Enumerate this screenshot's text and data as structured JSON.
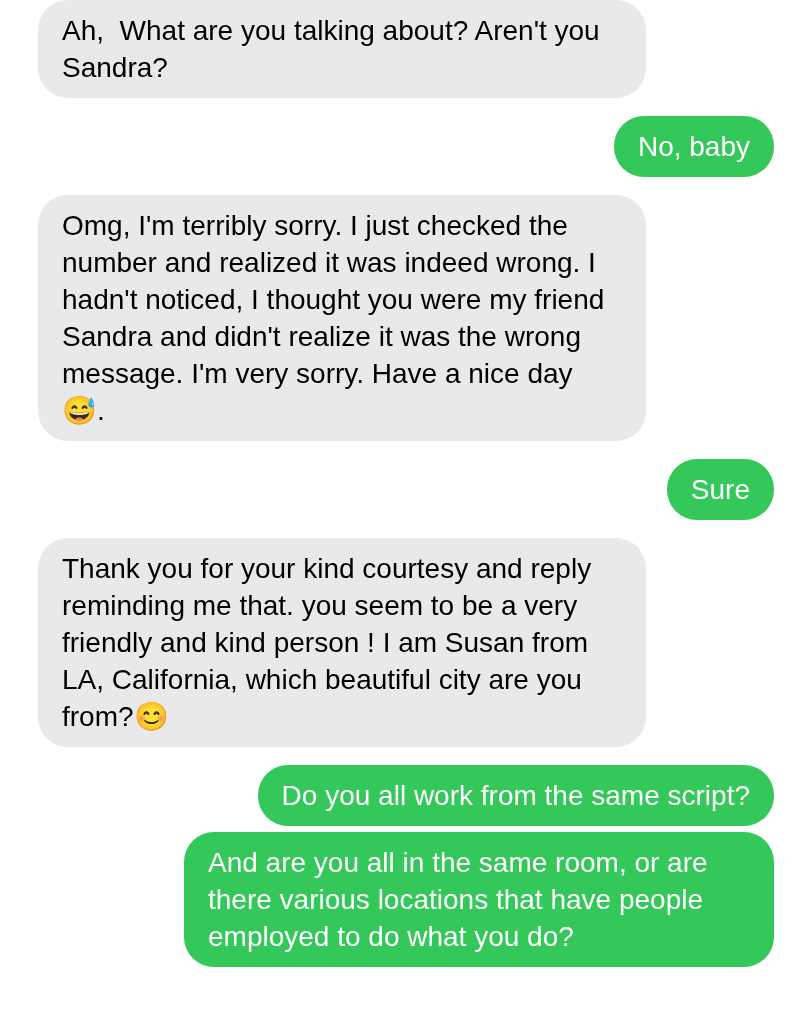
{
  "messages": [
    {
      "kind": "incoming",
      "text": "Ah,  What are you talking about? Aren't you Sandra?"
    },
    {
      "kind": "outgoing",
      "text": "No, baby"
    },
    {
      "kind": "incoming",
      "text": "Omg, I'm terribly sorry. I just checked the number and realized it was indeed wrong. I hadn't noticed, I thought you were my friend Sandra and didn't realize it was the wrong message. I'm very sorry. Have a nice day 😅."
    },
    {
      "kind": "outgoing",
      "text": "Sure"
    },
    {
      "kind": "incoming",
      "text": "Thank you for your kind courtesy and reply reminding me that. you seem to be a very friendly and kind person ! I am Susan from LA, California, which beautiful city are you from?😊"
    },
    {
      "kind": "outgoing",
      "text": "Do you all work from the same script?"
    },
    {
      "kind": "outgoing",
      "text": "And are you all in the same room, or are there various locations that have people employed to do what you do?"
    }
  ]
}
